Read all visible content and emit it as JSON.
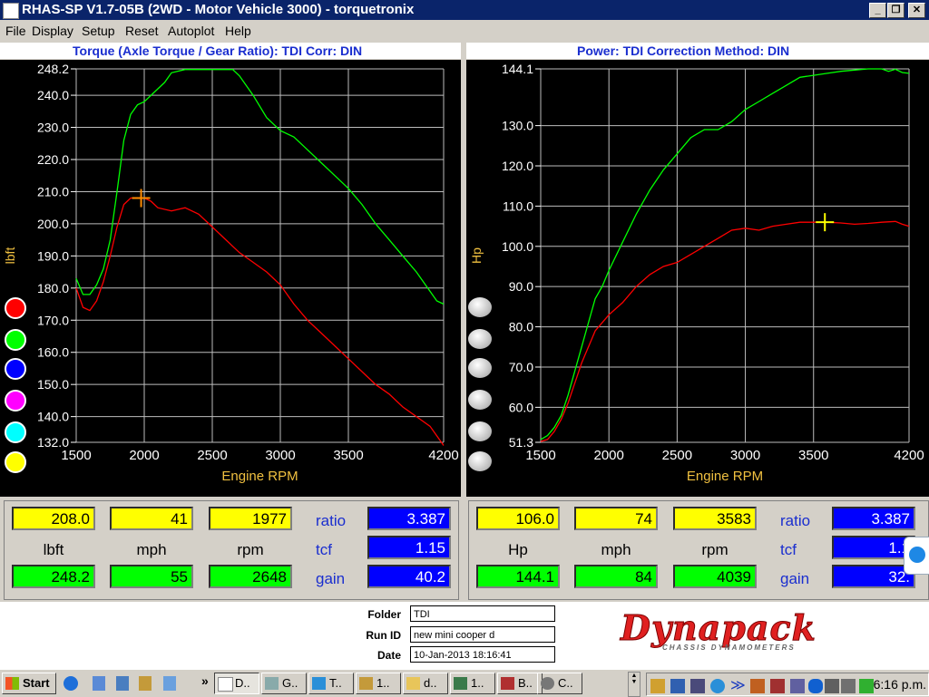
{
  "window": {
    "title": "RHAS-SP V1.7-05B   (2WD - Motor Vehicle 3000) - torquetronix"
  },
  "menu": [
    "File",
    "Display",
    "Setup",
    "Reset",
    "Autoplot",
    "Help"
  ],
  "left_panel": {
    "title": "Torque (Axle Torque / Gear Ratio): TDI     Corr: DIN",
    "values_top": [
      "208.0",
      "41",
      "1977"
    ],
    "units": [
      "lbft",
      "mph",
      "rpm"
    ],
    "values_bottom": [
      "248.2",
      "55",
      "2648"
    ],
    "ratio_label": "ratio",
    "ratio": "3.387",
    "tcf_label": "tcf",
    "tcf": "1.15",
    "gain_label": "gain",
    "gain": "40.2"
  },
  "right_panel": {
    "title": "Power: TDI     Correction Method: DIN",
    "values_top": [
      "106.0",
      "74",
      "3583"
    ],
    "units": [
      "Hp",
      "mph",
      "rpm"
    ],
    "values_bottom": [
      "144.1",
      "84",
      "4039"
    ],
    "ratio_label": "ratio",
    "ratio": "3.387",
    "tcf_label": "tcf",
    "tcf": "1.1",
    "gain_label": "gain",
    "gain": "32."
  },
  "color_swatches": [
    "#ff0000",
    "#00ff00",
    "#0000ff",
    "#ff00ff",
    "#00ffff",
    "#ffff00"
  ],
  "chart_data": [
    {
      "type": "line",
      "title": "",
      "xlabel": "Engine RPM",
      "ylabel": "lbft",
      "xlim": [
        1500,
        4200
      ],
      "ylim": [
        132.0,
        248.2
      ],
      "xticks": [
        "1500",
        "2000",
        "2500",
        "3000",
        "3500",
        "4200"
      ],
      "yticks": [
        "248.2",
        "240.0",
        "230.0",
        "220.0",
        "210.0",
        "200.0",
        "190.0",
        "180.0",
        "170.0",
        "160.0",
        "150.0",
        "140.0",
        "132.0"
      ],
      "grid": true,
      "cursor": {
        "x": 1977,
        "y": 208.0,
        "color": "#ff8c00"
      },
      "series": [
        {
          "color": "#00ff00",
          "x": [
            1500,
            1550,
            1600,
            1650,
            1700,
            1750,
            1800,
            1850,
            1900,
            1950,
            2000,
            2050,
            2100,
            2150,
            2200,
            2300,
            2400,
            2500,
            2600,
            2650,
            2700,
            2800,
            2900,
            3000,
            3100,
            3200,
            3300,
            3400,
            3500,
            3600,
            3700,
            3800,
            3900,
            4000,
            4100,
            4150,
            4200
          ],
          "y": [
            183,
            178,
            178,
            181,
            186,
            195,
            210,
            226,
            234,
            237,
            238,
            240,
            242,
            244,
            247,
            248,
            248,
            248,
            248,
            248,
            246,
            240,
            233,
            229,
            227,
            223,
            219,
            215,
            211,
            206,
            200,
            195,
            190,
            185,
            179,
            176,
            175
          ]
        },
        {
          "color": "#ff0000",
          "x": [
            1500,
            1550,
            1600,
            1650,
            1700,
            1750,
            1800,
            1850,
            1900,
            1950,
            2000,
            2050,
            2100,
            2200,
            2300,
            2400,
            2500,
            2600,
            2700,
            2800,
            2900,
            3000,
            3100,
            3200,
            3300,
            3400,
            3500,
            3600,
            3700,
            3800,
            3900,
            4000,
            4100,
            4150,
            4200
          ],
          "y": [
            180,
            174,
            173,
            176,
            182,
            190,
            199,
            206,
            208,
            208,
            208,
            207,
            205,
            204,
            205,
            203,
            199,
            195,
            191,
            188,
            185,
            181,
            175,
            170,
            166,
            162,
            158,
            154,
            150,
            147,
            143,
            140,
            137,
            134,
            131
          ]
        }
      ]
    },
    {
      "type": "line",
      "title": "",
      "xlabel": "Engine RPM",
      "ylabel": "Hp",
      "xlim": [
        1500,
        4200
      ],
      "ylim": [
        51.3,
        144.1
      ],
      "xticks": [
        "1500",
        "2000",
        "2500",
        "3000",
        "3500",
        "4200"
      ],
      "yticks": [
        "144.1",
        "130.0",
        "120.0",
        "110.0",
        "100.0",
        "90.0",
        "80.0",
        "70.0",
        "60.0",
        "51.3"
      ],
      "grid": true,
      "cursor": {
        "x": 3583,
        "y": 106.0,
        "color": "#ffff00"
      },
      "series": [
        {
          "color": "#00ff00",
          "x": [
            1500,
            1550,
            1600,
            1650,
            1700,
            1750,
            1800,
            1850,
            1900,
            1950,
            2000,
            2100,
            2200,
            2300,
            2400,
            2500,
            2600,
            2700,
            2800,
            2900,
            3000,
            3100,
            3200,
            3300,
            3400,
            3500,
            3600,
            3700,
            3800,
            3900,
            4000,
            4050,
            4100,
            4150,
            4200
          ],
          "y": [
            52,
            53,
            55,
            58,
            63,
            69,
            75,
            81,
            87,
            90,
            94,
            101,
            108,
            114,
            119,
            123,
            127,
            129,
            129,
            131,
            134,
            136,
            138,
            140,
            142,
            142.5,
            143,
            143.5,
            143.8,
            144.1,
            144.1,
            143.5,
            144,
            143.2,
            143
          ]
        },
        {
          "color": "#ff0000",
          "x": [
            1500,
            1550,
            1600,
            1650,
            1700,
            1750,
            1800,
            1850,
            1900,
            1950,
            2000,
            2100,
            2200,
            2300,
            2400,
            2500,
            2600,
            2700,
            2800,
            2900,
            3000,
            3100,
            3200,
            3300,
            3400,
            3500,
            3600,
            3700,
            3800,
            3900,
            4000,
            4100,
            4150,
            4200
          ],
          "y": [
            51.5,
            52,
            54,
            57,
            61,
            66,
            71,
            75,
            79,
            81,
            83,
            86,
            90,
            93,
            95,
            96,
            98,
            100,
            102,
            104,
            104.5,
            104,
            105,
            105.5,
            106,
            106,
            106,
            105.8,
            105.5,
            105.7,
            106,
            106.2,
            105.5,
            105
          ]
        }
      ]
    }
  ],
  "info": {
    "folder_label": "Folder",
    "folder": "TDI",
    "runid_label": "Run ID",
    "runid": "new mini cooper d",
    "date_label": "Date",
    "date": "10-Jan-2013  18:16:41",
    "logo": "Dynapack",
    "logo_sub": "CHASSIS DYNAMOMETERS"
  },
  "taskbar": {
    "start": "Start",
    "buttons": [
      "D..",
      "G..",
      "T..",
      "1..",
      "d..",
      "1..",
      "B..",
      "C.."
    ],
    "clock": "6:16 p.m."
  }
}
